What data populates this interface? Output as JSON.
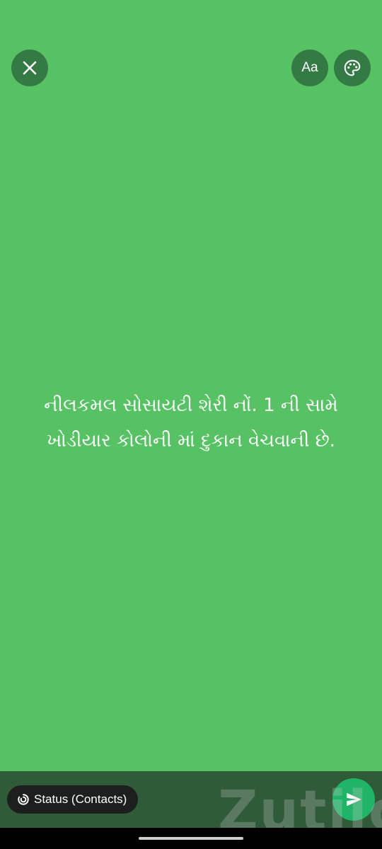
{
  "status_text": {
    "line1": "નીલકમલ સોસાયટી શેરી નોં. 1 ની સામે",
    "line2": "ખોડીયાર કોલોની માં દુકાન વેચવાની છે."
  },
  "toolbar": {
    "close_icon": "close-icon",
    "font_label": "Aa",
    "palette_icon": "palette-icon"
  },
  "bottom_bar": {
    "audience_label": "Status (Contacts)",
    "audience_icon": "status-ring-icon",
    "send_icon": "send-icon"
  },
  "watermark": {
    "text": "Zutilo"
  },
  "colors": {
    "background": "#56c264",
    "button_bg": "#347a45",
    "bottom_bar": "#2f5b39",
    "pill_bg": "#1c1f1d",
    "send_bg": "#20b466"
  }
}
